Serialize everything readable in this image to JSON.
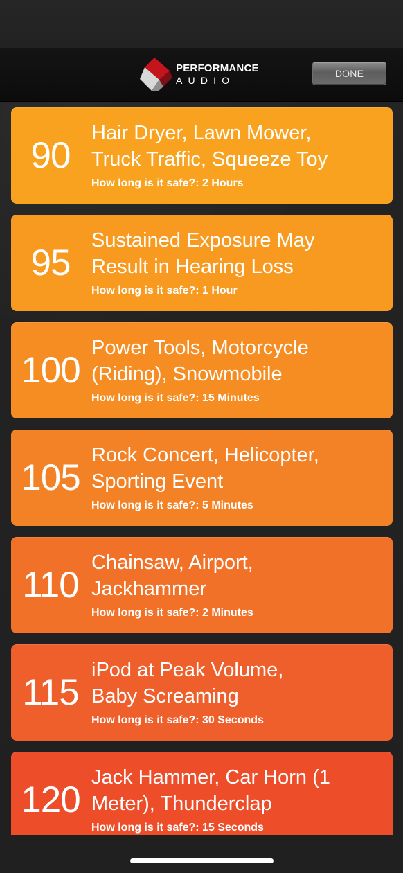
{
  "header": {
    "brand_line_1": "PERFORMANCE",
    "brand_line_2": "AUDIO",
    "done_label": "DONE"
  },
  "levels": [
    {
      "value": "90",
      "title": "Hair Dryer, Lawn Mower,\nTruck Traffic, Squeeze Toy",
      "safe": "How long is it safe?: 2 Hours",
      "color": "#f8a21f"
    },
    {
      "value": "95",
      "title": "Sustained Exposure May\nResult in Hearing Loss",
      "safe": "How long is it safe?: 1 Hour",
      "color": "#f89a20"
    },
    {
      "value": "100",
      "title": "Power Tools, Motorcycle\n(Riding), Snowmobile",
      "safe": "How long is it safe?: 15 Minutes",
      "color": "#f58d22"
    },
    {
      "value": "105",
      "title": "Rock Concert, Helicopter,\nSporting Event",
      "safe": "How long is it safe?: 5 Minutes",
      "color": "#f38125"
    },
    {
      "value": "110",
      "title": "Chainsaw, Airport,\nJackhammer",
      "safe": "How long is it safe?: 2 Minutes",
      "color": "#f17128"
    },
    {
      "value": "115",
      "title": "iPod at Peak Volume,\nBaby Screaming",
      "safe": "How long is it safe?: 30 Seconds",
      "color": "#ef5f2b"
    },
    {
      "value": "120",
      "title": "Jack Hammer, Car Horn (1\nMeter), Thunderclap",
      "safe": "How long is it safe?: 15 Seconds",
      "color": "#ee4d2a"
    }
  ]
}
